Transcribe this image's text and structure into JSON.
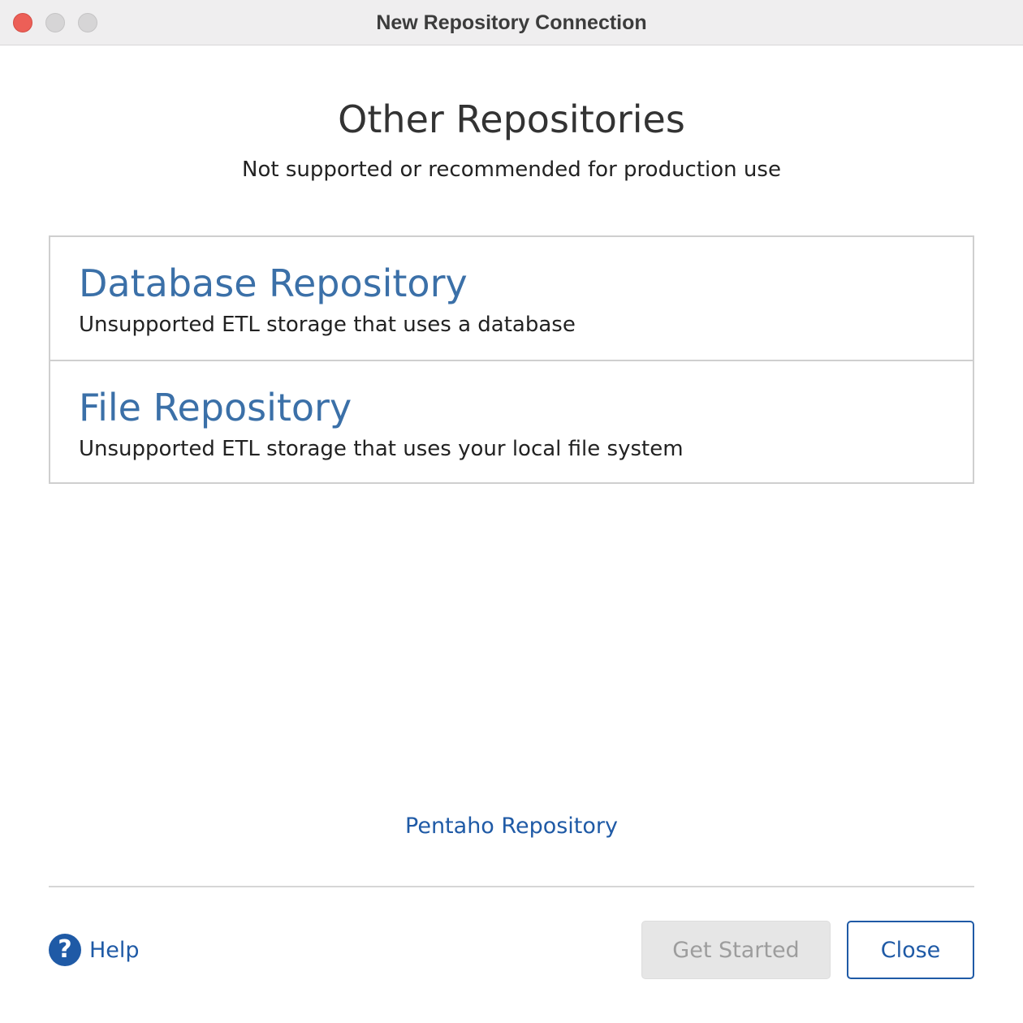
{
  "window": {
    "title": "New Repository Connection"
  },
  "header": {
    "title": "Other Repositories",
    "subtitle": "Not supported or recommended for production use"
  },
  "options": [
    {
      "title": "Database Repository",
      "description": "Unsupported ETL storage that uses a database"
    },
    {
      "title": "File Repository",
      "description": "Unsupported ETL storage that uses your local file system"
    }
  ],
  "links": {
    "pentaho": "Pentaho Repository"
  },
  "footer": {
    "help_label": "Help",
    "help_icon": "?",
    "get_started_label": "Get Started",
    "close_label": "Close"
  },
  "colors": {
    "accent": "#1f5aa6",
    "option_title": "#3b70a8",
    "close_traffic": "#ec5f57",
    "disabled_button_bg": "#e6e6e6"
  },
  "icons": {
    "help": "question-circle-icon"
  }
}
